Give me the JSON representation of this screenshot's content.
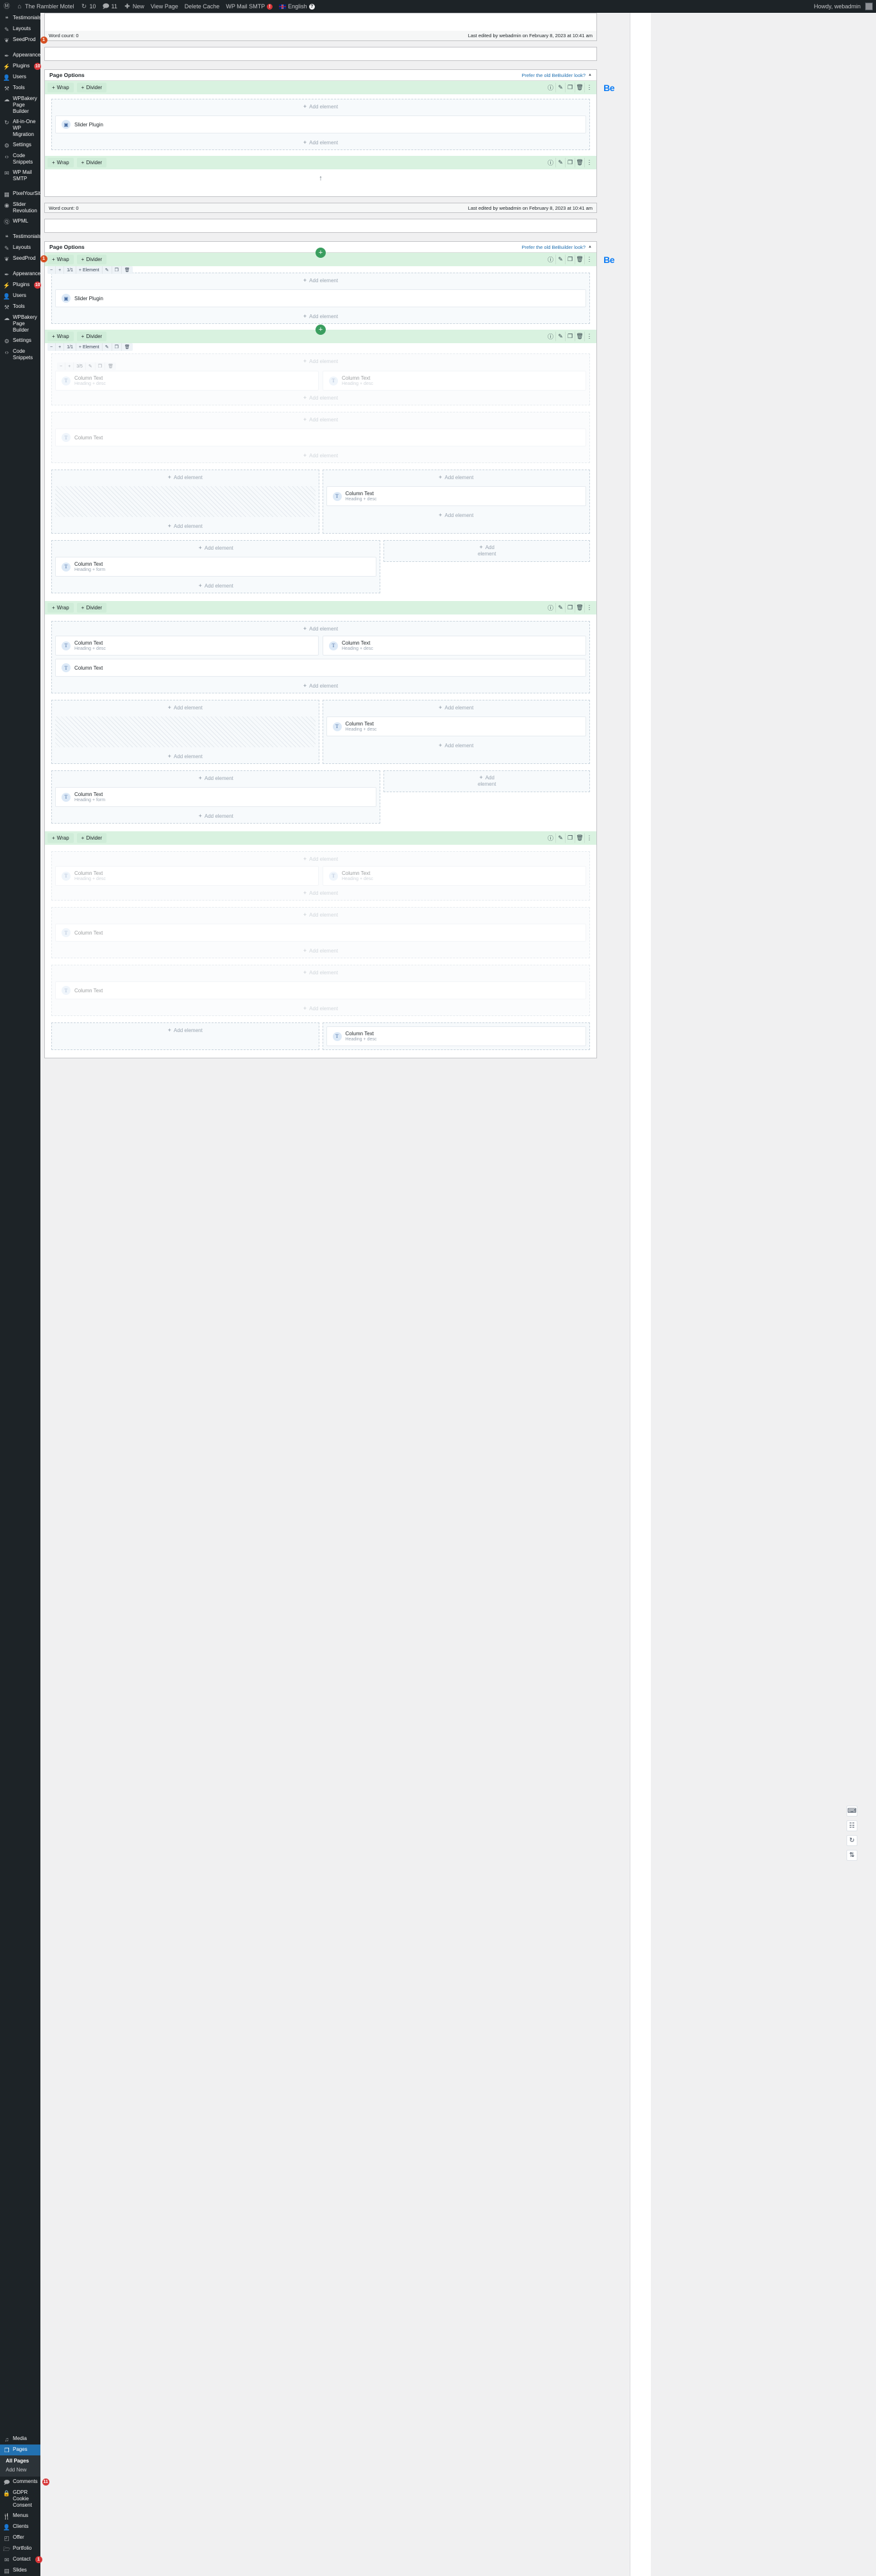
{
  "adminbar": {
    "site_name": "The Rambler Motel",
    "updates_count": "10",
    "comments_count": "11",
    "new_label": "New",
    "view_page_label": "View Page",
    "delete_cache_label": "Delete Cache",
    "wp_mail_smtp_label": "WP Mail SMTP",
    "wp_mail_smtp_badge": "!",
    "language_label": "English",
    "help_badge": "?",
    "howdy_label": "Howdy, webadmin"
  },
  "sidebar": {
    "items": [
      {
        "label": "Testimonials",
        "icon": "quote-icon",
        "badge": "",
        "sep": false
      },
      {
        "label": "Layouts",
        "icon": "pencil-icon",
        "badge": "",
        "sep": false
      },
      {
        "label": "SeedProd",
        "icon": "leaf-icon",
        "badge": "1",
        "badge_color": "orange",
        "sep": false
      },
      {
        "label": "Appearance",
        "icon": "brush-icon",
        "badge": "",
        "sep": true
      },
      {
        "label": "Plugins",
        "icon": "plug-icon",
        "badge": "10",
        "sep": false
      },
      {
        "label": "Users",
        "icon": "user-icon",
        "badge": "",
        "sep": false
      },
      {
        "label": "Tools",
        "icon": "wrench-icon",
        "badge": "",
        "sep": false
      },
      {
        "label": "WPBakery Page Builder",
        "icon": "cloud-icon",
        "badge": "",
        "sep": false
      },
      {
        "label": "All-in-One WP Migration",
        "icon": "migrate-icon",
        "badge": "",
        "sep": false
      },
      {
        "label": "Settings",
        "icon": "sliders-icon",
        "badge": "",
        "sep": false
      },
      {
        "label": "Code Snippets",
        "icon": "code-icon",
        "badge": "",
        "sep": false
      },
      {
        "label": "WP Mail SMTP",
        "icon": "envelope-arrow-icon",
        "badge": "",
        "sep": false
      },
      {
        "label": "PixelYourSite",
        "icon": "pixel-icon",
        "badge": "",
        "sep": true
      },
      {
        "label": "Slider Revolution",
        "icon": "slider-icon",
        "badge": "",
        "sep": false
      },
      {
        "label": "WPML",
        "icon": "wpml-icon",
        "badge": "",
        "sep": false
      },
      {
        "label": "Testimonials",
        "icon": "quote-icon",
        "badge": "",
        "sep": true
      },
      {
        "label": "Layouts",
        "icon": "pencil-icon",
        "badge": "",
        "sep": false
      },
      {
        "label": "SeedProd",
        "icon": "leaf-icon",
        "badge": "1",
        "badge_color": "orange",
        "sep": false
      },
      {
        "label": "Appearance",
        "icon": "brush-icon",
        "badge": "",
        "sep": true
      },
      {
        "label": "Plugins",
        "icon": "plug-icon",
        "badge": "10",
        "sep": false
      },
      {
        "label": "Users",
        "icon": "user-icon",
        "badge": "",
        "sep": false
      },
      {
        "label": "Tools",
        "icon": "wrench-icon",
        "badge": "",
        "sep": false
      },
      {
        "label": "WPBakery Page Builder",
        "icon": "cloud-icon",
        "badge": "",
        "sep": false
      },
      {
        "label": "Settings",
        "icon": "sliders-icon",
        "badge": "",
        "sep": false
      },
      {
        "label": "Code Snippets",
        "icon": "code-icon",
        "badge": "",
        "sep": false
      }
    ],
    "bottom_items": [
      {
        "label": "Media",
        "icon": "media-icon",
        "badge": "",
        "active": false
      },
      {
        "label": "Pages",
        "icon": "pages-icon",
        "badge": "",
        "active": true
      },
      {
        "label": "Comments",
        "icon": "comment-icon",
        "badge": "11",
        "active": false
      },
      {
        "label": "GDPR Cookie Consent",
        "icon": "lock-icon",
        "badge": "",
        "active": false
      },
      {
        "label": "Menus",
        "icon": "cutlery-icon",
        "badge": "",
        "active": false
      },
      {
        "label": "Clients",
        "icon": "client-icon",
        "badge": "",
        "active": false
      },
      {
        "label": "Offer",
        "icon": "tag-icon",
        "badge": "",
        "active": false
      },
      {
        "label": "Portfolio",
        "icon": "folder-icon",
        "badge": "",
        "active": false
      },
      {
        "label": "Contact",
        "icon": "envelope-icon",
        "badge": "1",
        "active": false
      },
      {
        "label": "Slides",
        "icon": "slides-icon",
        "badge": "",
        "active": false
      }
    ],
    "pages_submenu": [
      {
        "label": "All Pages",
        "current": true
      },
      {
        "label": "Add New",
        "current": false
      }
    ]
  },
  "editor": {
    "word_count_label": "Word count: 0",
    "last_edited_label": "Last edited by webadmin on February 8, 2023 at 10:41 am",
    "metabox_title": "Page Options",
    "prefer_old_link": "Prefer the old BeBuilder look?",
    "collapse_caret": "▲",
    "be_logo": "Be"
  },
  "builder": {
    "wrap_label": "Wrap",
    "divider_label": "Divider",
    "element_label": "Element",
    "add_element_label": "Add element",
    "add_label": "Add",
    "element_word": "element",
    "plus": "+",
    "minus": "−",
    "ratio_full": "1/1",
    "ratio_3_5": "3/5",
    "row_icons": [
      "info-icon",
      "pencil-icon",
      "copy-icon",
      "trash-icon",
      "kebab-icon"
    ],
    "toolbar_icons": [
      "pencil-icon",
      "copy-icon",
      "trash-icon"
    ],
    "float_icons": [
      "insert-section-icon",
      "add-template-icon",
      "history-icon",
      "reorder-icon"
    ]
  },
  "elements": {
    "slider_plugin": "Slider Plugin",
    "column_text": "Column Text",
    "heading_desc": "Heading + desc",
    "heading_form": "Heading + form",
    "t_glyph": "T"
  },
  "colors": {
    "admin_bg": "#1d2327",
    "accent_blue": "#2271b1",
    "section_green": "#d9f2e0",
    "plus_green": "#3a9e5f",
    "badge_red": "#d63638",
    "be_blue": "#0a7bf5"
  }
}
